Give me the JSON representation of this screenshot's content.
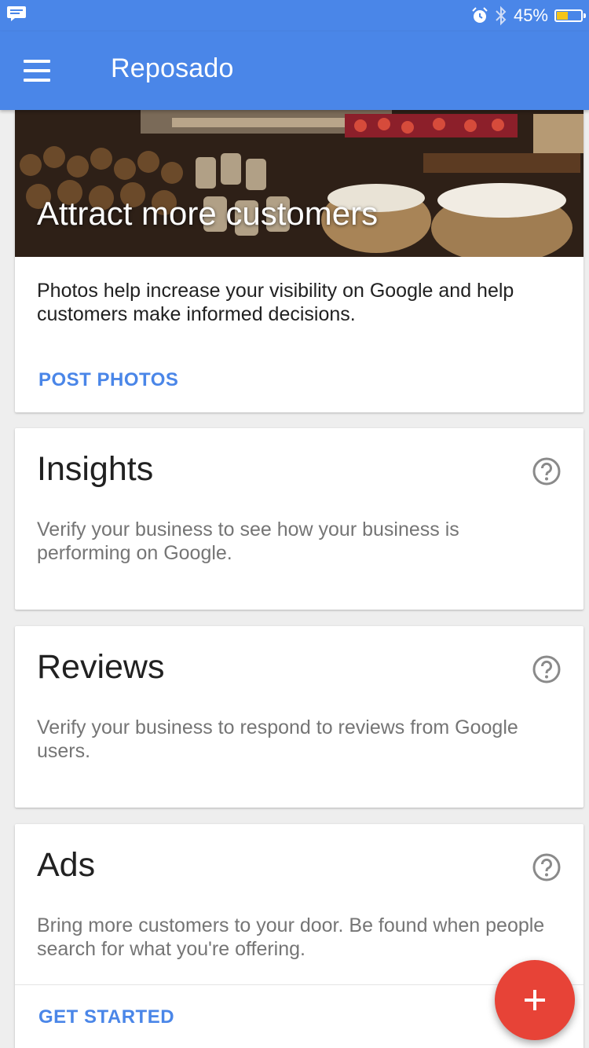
{
  "status_bar": {
    "battery_percent": "45%",
    "battery_level": 0.45,
    "icons": [
      "message-icon",
      "alarm-icon",
      "bluetooth-icon",
      "battery-icon"
    ]
  },
  "app_bar": {
    "title": "Reposado",
    "menu_icon": "hamburger-menu-icon"
  },
  "photos_card": {
    "hero_title": "Attract more customers",
    "body": "Photos help increase your visibility on Google and help customers make informed decisions.",
    "action_label": "POST PHOTOS"
  },
  "insights_card": {
    "heading": "Insights",
    "description": "Verify your business to see how your business is performing on Google."
  },
  "reviews_card": {
    "heading": "Reviews",
    "description": "Verify your business to respond to reviews from Google users."
  },
  "ads_card": {
    "heading": "Ads",
    "description": "Bring more customers to your door. Be found when people search for what you're offering.",
    "action_label": "GET STARTED"
  },
  "fab": {
    "icon": "plus-icon"
  },
  "colors": {
    "primary": "#4a86e8",
    "fab": "#e74337",
    "battery_fill": "#f5c518"
  }
}
